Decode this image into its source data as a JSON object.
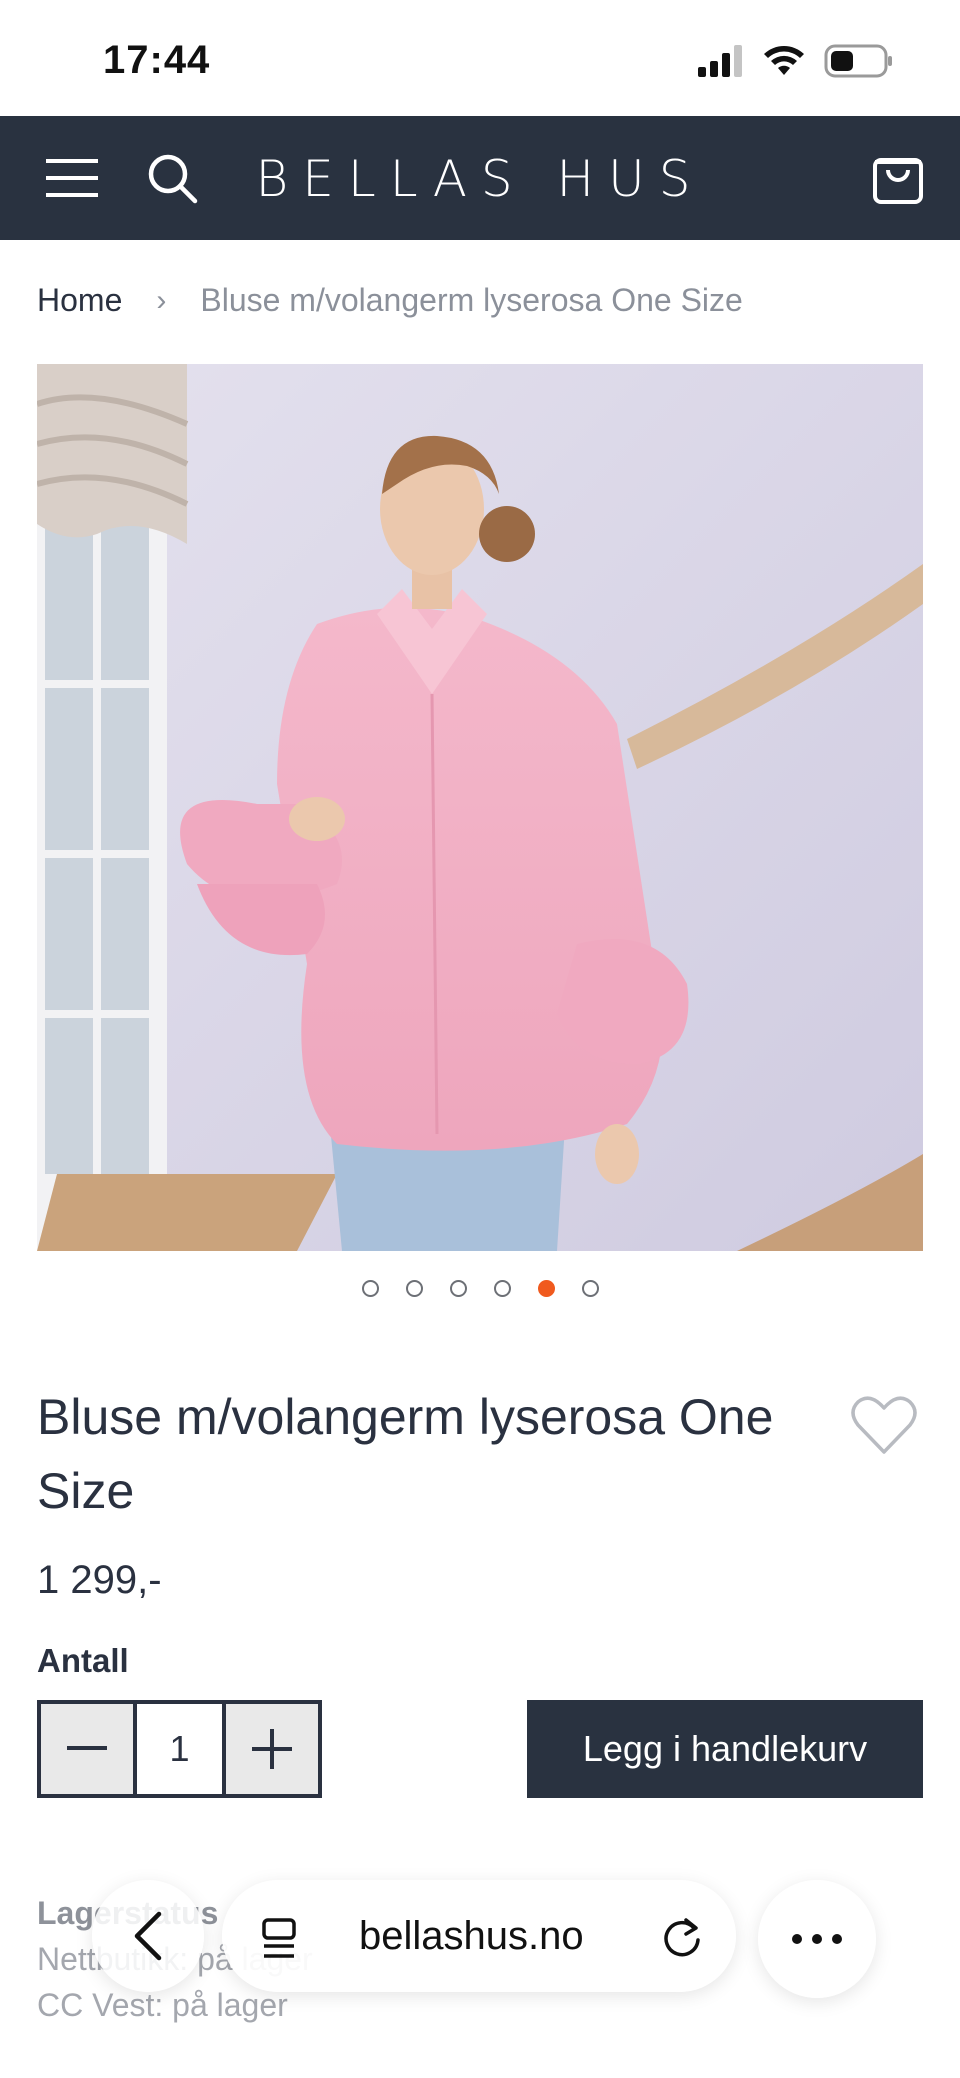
{
  "status_bar": {
    "time": "17:44"
  },
  "header": {
    "logo": "BELLAS HUS",
    "menu_icon": "hamburger-menu-icon",
    "search_icon": "search-icon",
    "cart_icon": "shopping-bag-icon",
    "background": "#293240"
  },
  "breadcrumb": {
    "home": "Home",
    "separator": "›",
    "current": "Bluse m/volangerm lyserosa One Size"
  },
  "gallery": {
    "image_alt": "Model in pink blouse with ruffled sleeves",
    "image_count": 6,
    "active_index": 4,
    "active_color": "#f05a1e"
  },
  "product": {
    "title": "Bluse m/volangerm lyserosa One Size",
    "price": "1 299,-",
    "quantity_label": "Antall",
    "quantity": "1",
    "add_to_cart": "Legg i handlekurv"
  },
  "stock": {
    "title": "Lagerstatus",
    "lines": [
      "Nettbutikk: på lager",
      "CC Vest: på lager"
    ]
  },
  "browser": {
    "url": "bellashus.no"
  }
}
